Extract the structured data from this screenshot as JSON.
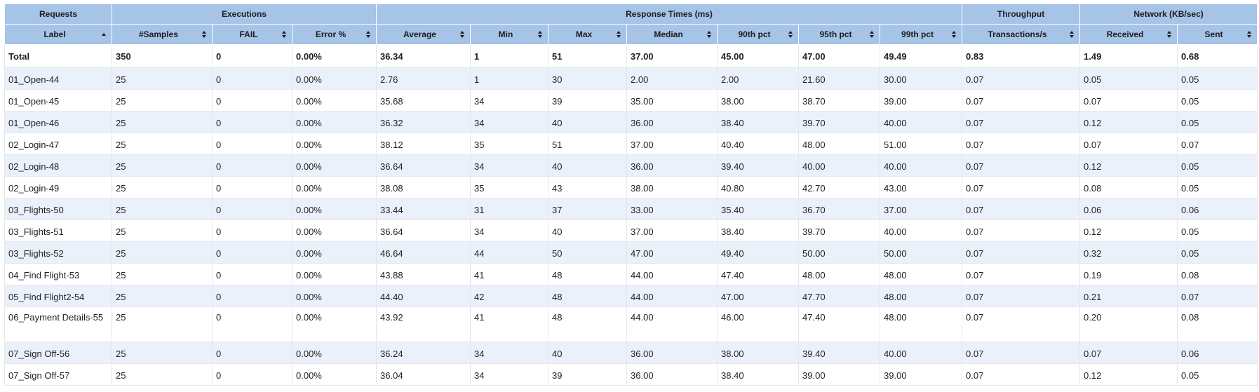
{
  "groups": {
    "requests": "Requests",
    "executions": "Executions",
    "response_times": "Response Times (ms)",
    "throughput": "Throughput",
    "network": "Network (KB/sec)"
  },
  "columns": {
    "label": "Label",
    "samples": "#Samples",
    "fail": "FAIL",
    "error": "Error %",
    "average": "Average",
    "min": "Min",
    "max": "Max",
    "median": "Median",
    "p90": "90th pct",
    "p95": "95th pct",
    "p99": "99th pct",
    "tps": "Transactions/s",
    "received": "Received",
    "sent": "Sent"
  },
  "sort": {
    "column": "Label",
    "direction": "ascending"
  },
  "total": [
    "Total",
    "350",
    "0",
    "0.00%",
    "36.34",
    "1",
    "51",
    "37.00",
    "45.00",
    "47.00",
    "49.49",
    "0.83",
    "1.49",
    "0.68"
  ],
  "rows": [
    [
      "01_Open-44",
      "25",
      "0",
      "0.00%",
      "2.76",
      "1",
      "30",
      "2.00",
      "2.00",
      "21.60",
      "30.00",
      "0.07",
      "0.05",
      "0.05"
    ],
    [
      "01_Open-45",
      "25",
      "0",
      "0.00%",
      "35.68",
      "34",
      "39",
      "35.00",
      "38.00",
      "38.70",
      "39.00",
      "0.07",
      "0.07",
      "0.05"
    ],
    [
      "01_Open-46",
      "25",
      "0",
      "0.00%",
      "36.32",
      "34",
      "40",
      "36.00",
      "38.40",
      "39.70",
      "40.00",
      "0.07",
      "0.12",
      "0.05"
    ],
    [
      "02_Login-47",
      "25",
      "0",
      "0.00%",
      "38.12",
      "35",
      "51",
      "37.00",
      "40.40",
      "48.00",
      "51.00",
      "0.07",
      "0.07",
      "0.07"
    ],
    [
      "02_Login-48",
      "25",
      "0",
      "0.00%",
      "36.64",
      "34",
      "40",
      "36.00",
      "39.40",
      "40.00",
      "40.00",
      "0.07",
      "0.12",
      "0.05"
    ],
    [
      "02_Login-49",
      "25",
      "0",
      "0.00%",
      "38.08",
      "35",
      "43",
      "38.00",
      "40.80",
      "42.70",
      "43.00",
      "0.07",
      "0.08",
      "0.05"
    ],
    [
      "03_Flights-50",
      "25",
      "0",
      "0.00%",
      "33.44",
      "31",
      "37",
      "33.00",
      "35.40",
      "36.70",
      "37.00",
      "0.07",
      "0.06",
      "0.06"
    ],
    [
      "03_Flights-51",
      "25",
      "0",
      "0.00%",
      "36.64",
      "34",
      "40",
      "37.00",
      "38.40",
      "39.70",
      "40.00",
      "0.07",
      "0.12",
      "0.05"
    ],
    [
      "03_Flights-52",
      "25",
      "0",
      "0.00%",
      "46.64",
      "44",
      "50",
      "47.00",
      "49.40",
      "50.00",
      "50.00",
      "0.07",
      "0.32",
      "0.05"
    ],
    [
      "04_Find Flight-53",
      "25",
      "0",
      "0.00%",
      "43.88",
      "41",
      "48",
      "44.00",
      "47.40",
      "48.00",
      "48.00",
      "0.07",
      "0.19",
      "0.08"
    ],
    [
      "05_Find Flight2-54",
      "25",
      "0",
      "0.00%",
      "44.40",
      "42",
      "48",
      "44.00",
      "47.00",
      "47.70",
      "48.00",
      "0.07",
      "0.21",
      "0.07"
    ],
    [
      "06_Payment Details-55",
      "25",
      "0",
      "0.00%",
      "43.92",
      "41",
      "48",
      "44.00",
      "46.00",
      "47.40",
      "48.00",
      "0.07",
      "0.20",
      "0.08"
    ],
    [
      "07_Sign Off-56",
      "25",
      "0",
      "0.00%",
      "36.24",
      "34",
      "40",
      "36.00",
      "38.00",
      "39.40",
      "40.00",
      "0.07",
      "0.07",
      "0.06"
    ],
    [
      "07_Sign Off-57",
      "25",
      "0",
      "0.00%",
      "36.04",
      "34",
      "39",
      "36.00",
      "38.40",
      "39.00",
      "39.00",
      "0.07",
      "0.12",
      "0.05"
    ]
  ],
  "colors": {
    "header_bg": "#a6c3e8",
    "row_alt_bg": "#eaf1fa",
    "row_bg": "#ffffff"
  }
}
